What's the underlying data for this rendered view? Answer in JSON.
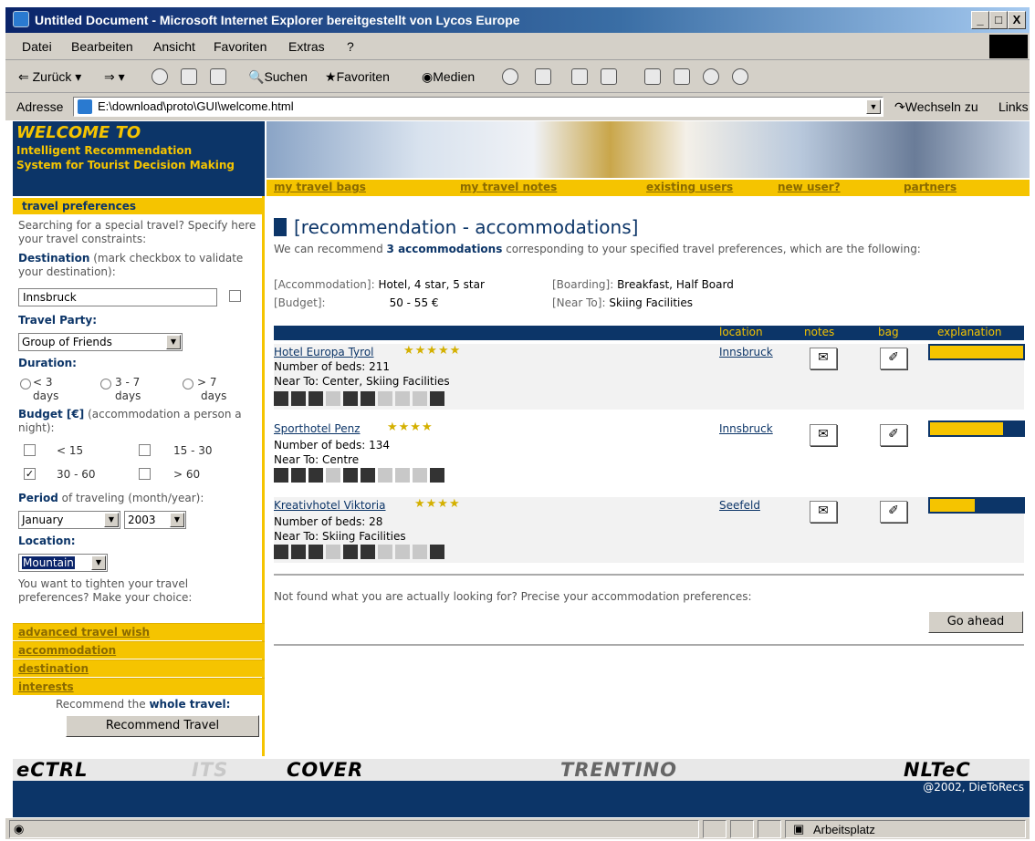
{
  "window": {
    "title": "Untitled Document - Microsoft Internet Explorer bereitgestellt von Lycos Europe",
    "minimize": "_",
    "maximize": "□",
    "close": "X"
  },
  "menu": [
    "Datei",
    "Bearbeiten",
    "Ansicht",
    "Favoriten",
    "Extras",
    "?"
  ],
  "toolbar": {
    "back": "Zurück",
    "search": "Suchen",
    "favorites": "Favoriten",
    "media": "Medien"
  },
  "address": {
    "label": "Adresse",
    "value": "E:\\download\\proto\\GUI\\welcome.html",
    "go": "Wechseln zu",
    "links": "Links"
  },
  "sidebar": {
    "welcome": "WELCOME TO",
    "subtitle1": "Intelligent Recommendation",
    "subtitle2": "System for Tourist Decision Making",
    "pref_header": "travel preferences",
    "intro": "Searching for a special travel? Specify here your travel constraints:",
    "destination_label": "Destination",
    "destination_hint": "(mark checkbox to validate your destination):",
    "destination_value": "Innsbruck",
    "party_label": "Travel Party",
    "party_value": "Group of Friends",
    "duration_label": "Duration",
    "duration_opts": [
      "< 3",
      "3 - 7",
      "> 7"
    ],
    "duration_unit": "days",
    "budget_label": "Budget [€]",
    "budget_hint": "(accommodation a person a night):",
    "budget_opts": [
      "< 15",
      "15 - 30",
      "30 - 60",
      "> 60"
    ],
    "budget_checked_mark": "✓",
    "period_label": "Period",
    "period_hint": "of traveling (month/year):",
    "month": "January",
    "year": "2003",
    "location_label": "Location",
    "location_value": "Mountain",
    "tighten": "You want to tighten your travel preferences? Make your choice:",
    "links": [
      "advanced travel wish",
      "accommodation",
      "destination",
      "interests"
    ],
    "recommend_text": "Recommend the",
    "recommend_bold": "whole travel:",
    "recommend_button": "Recommend Travel"
  },
  "nav": [
    "my travel bags",
    "my travel notes",
    "existing users",
    "new user?",
    "partners"
  ],
  "main": {
    "title": "[recommendation - accommodations]",
    "intro_pre": "We can recommend",
    "intro_bold": "3 accommodations",
    "intro_post": "corresponding to your specified travel preferences, which are the following:",
    "criteria": [
      {
        "key": "[Accommodation]:",
        "value": "Hotel, 4 star, 5 star"
      },
      {
        "key": "[Boarding]:",
        "value": "Breakfast, Half Board"
      },
      {
        "key": "[Budget]:",
        "value": "50 - 55 €"
      },
      {
        "key": "[Near To]:",
        "value": "Skiing Facilities"
      }
    ],
    "columns": [
      "location",
      "notes",
      "bag",
      "explanation"
    ],
    "hotels": [
      {
        "name": "Hotel Europa Tyrol",
        "stars": "★★★★★",
        "beds": "Number of beds: 211",
        "near": "Near To: Center, Skiing Facilities",
        "location": "Innsbruck",
        "explanation": 1.0
      },
      {
        "name": "Sporthotel Penz",
        "stars": "★★★★",
        "beds": "Number of beds: 134",
        "near": "Near To: Centre",
        "location": "Innsbruck",
        "explanation": 0.78
      },
      {
        "name": "Kreativhotel Viktoria",
        "stars": "★★★★",
        "beds": "Number of beds: 28",
        "near": "Near To: Skiing Facilities",
        "location": "Seefeld",
        "explanation": 0.48
      }
    ],
    "notes_icon": "✉",
    "bag_icon": "✐",
    "not_found": "Not found what you are actually looking for? Precise your accommodation preferences:",
    "go_button": "Go ahead"
  },
  "footer": {
    "logos": [
      "eCTRL",
      "ITS",
      "COVER",
      "TRENTINO",
      "NLTeC"
    ],
    "copyright": "@2002, DieToRecs"
  },
  "status": {
    "zone": "Arbeitsplatz"
  }
}
